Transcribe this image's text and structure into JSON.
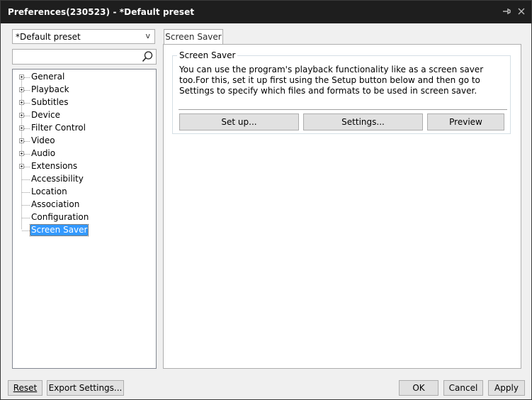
{
  "window": {
    "title": "Preferences(230523) - *Default preset",
    "pin_icon": "pin-icon",
    "close_icon": "close-icon"
  },
  "left": {
    "preset_value": "*Default preset",
    "preset_arrow": "v",
    "search_value": "",
    "tree": [
      {
        "label": "General",
        "expandable": true
      },
      {
        "label": "Playback",
        "expandable": true
      },
      {
        "label": "Subtitles",
        "expandable": true
      },
      {
        "label": "Device",
        "expandable": true
      },
      {
        "label": "Filter Control",
        "expandable": true
      },
      {
        "label": "Video",
        "expandable": true
      },
      {
        "label": "Audio",
        "expandable": true
      },
      {
        "label": "Extensions",
        "expandable": true
      },
      {
        "label": "Accessibility",
        "expandable": false
      },
      {
        "label": "Location",
        "expandable": false
      },
      {
        "label": "Association",
        "expandable": false
      },
      {
        "label": "Configuration",
        "expandable": false
      },
      {
        "label": "Screen Saver",
        "expandable": false,
        "selected": true
      }
    ]
  },
  "right": {
    "tab_label": "Screen Saver",
    "group_label": "Screen Saver",
    "description": "You can use the program's playback functionality like as a screen saver too.For this, set it up first using the Setup button below and then go to Settings to specify which files and formats to be used in screen saver.",
    "buttons": {
      "setup": "Set up...",
      "settings": "Settings...",
      "preview": "Preview"
    }
  },
  "footer": {
    "reset": "Reset",
    "export": "Export Settings...",
    "ok": "OK",
    "cancel": "Cancel",
    "apply": "Apply"
  }
}
